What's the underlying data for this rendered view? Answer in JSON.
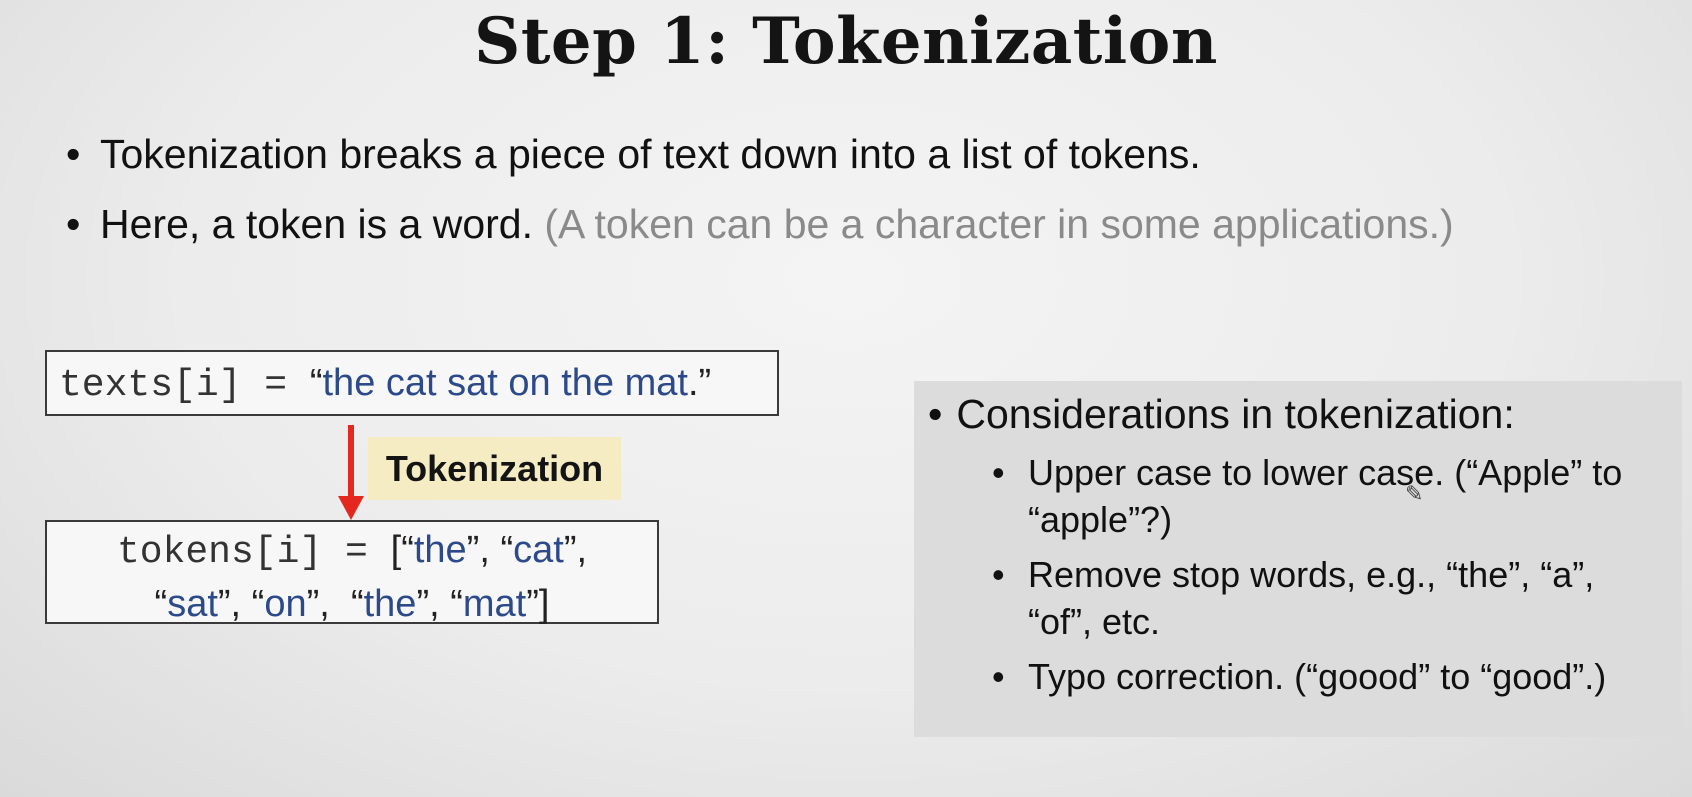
{
  "title": "Step 1: Tokenization",
  "bullets": [
    {
      "main": "Tokenization breaks a piece of text down into a list of tokens.",
      "aside": ""
    },
    {
      "main": "Here, a token is a word. ",
      "aside": "(A token can be a character in some applications.)"
    }
  ],
  "texts_box": {
    "code": "texts[i] = ",
    "open_quote": "“",
    "string": "the cat sat on the mat",
    "close_quote": ".”"
  },
  "arrow_label": "Tokenization",
  "tokens_box": {
    "code": "tokens[i] = ",
    "line1_tokens": [
      "the",
      "cat"
    ],
    "line2_tokens": [
      "sat",
      "on",
      "the",
      "mat"
    ]
  },
  "considerations": {
    "heading": "Considerations in tokenization:",
    "items": [
      "Upper case to lower case. (“Apple” to “apple”?)",
      "Remove stop words, e.g., “the”, “a”, “of”, etc.",
      "Typo correction. (“goood” to “good”.)"
    ]
  },
  "colors": {
    "code_blue": "#2c4a8a",
    "arrow": "#e4281f",
    "label_bg": "#f6ecc3",
    "panel_bg": "#dcdcdc"
  },
  "icons": {
    "cursor": "pencil-cursor-icon"
  }
}
